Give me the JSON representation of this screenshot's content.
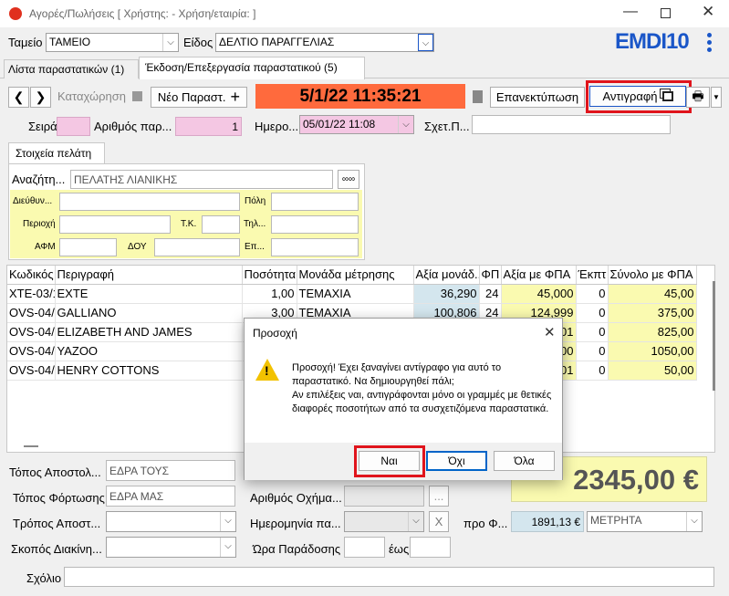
{
  "window": {
    "title": "Αγορές/Πωλήσεις  [ Χρήστης:             - Χρήση/εταιρία:             ]"
  },
  "header": {
    "cash_label": "Ταμείο",
    "cash_value": "ΤΑΜΕΙΟ",
    "type_label": "Είδος",
    "type_value": "ΔΕΛΤΙΟ ΠΑΡΑΓΓΕΛΙΑΣ",
    "logo": "EMDI10"
  },
  "tabs": [
    "Λίστα παραστατικών (1)",
    "Έκδοση/Επεξεργασία παραστατικού (5)"
  ],
  "toolbar": {
    "save_label": "Καταχώρηση",
    "new_label": "Νέο Παραστ.",
    "datetime": "5/1/22 11:35:21",
    "reprint_label": "Επανεκτύπωση",
    "copy_label": "Αντιγραφή"
  },
  "doc": {
    "series_label": "Σειρά",
    "number_label": "Αριθμός παρ...",
    "number_value": "1",
    "date_label": "Ημερο...",
    "date_value": "05/01/22 11:08",
    "related_label": "Σχετ.Π..."
  },
  "customer": {
    "section_label": "Στοιχεία πελάτη",
    "search_label": "Αναζήτη...",
    "search_value": "ΠΕΛΑΤΗΣ ΛΙΑΝΙΚΗΣ",
    "more_label": "∞∞",
    "address_label": "Διεύθυν...",
    "city_label": "Πόλη",
    "area_label": "Περιοχή",
    "zip_label": "Τ.Κ.",
    "phone_label": "Τηλ...",
    "vat_label": "ΑΦΜ",
    "tax_office_label": "ΔΟΥ",
    "job_label": "Επ..."
  },
  "grid": {
    "columns": [
      "Κωδικός",
      "Περιγραφή",
      "Ποσότητα",
      "Μονάδα μέτρησης",
      "Αξία μονάδ...",
      "ΦΠ",
      "Αξία με ΦΠΑ",
      "Έκπτ",
      "Σύνολο με ΦΠΑ"
    ],
    "rows": [
      [
        "XTE-03/1",
        "EXTE",
        "1,00",
        "ΤΕΜΑΧΙΑ",
        "36,290",
        "24",
        "45,000",
        "0",
        "45,00"
      ],
      [
        "OVS-04/",
        "GALLIANO",
        "3,00",
        "ΤΕΜΑΧΙΑ",
        "100,806",
        "24",
        "124,999",
        "0",
        "375,00"
      ],
      [
        "OVS-04/",
        "ELIZABETH AND JAMES",
        "",
        "",
        "",
        "",
        "01",
        "0",
        "825,00"
      ],
      [
        "OVS-04/",
        "YAZOO",
        "",
        "",
        "",
        "",
        "00",
        "0",
        "1050,00"
      ],
      [
        "OVS-04/",
        "HENRY COTTONS",
        "",
        "",
        "",
        "",
        "01",
        "0",
        "50,00"
      ]
    ]
  },
  "footer": {
    "ship_from_label": "Τόπος Αποστολ...",
    "ship_from_value": "ΕΔΡΑ ΤΟΥΣ",
    "load_place_label": "Τόπος Φόρτωσης",
    "load_place_value": "ΕΔΡΑ ΜΑΣ",
    "vehicle_label": "Αριθμός Οχήμα...",
    "ship_method_label": "Τρόπος Αποστ...",
    "date2_label": "Ημερομηνία πα...",
    "purpose_label": "Σκοπός Διακίνη...",
    "delivery_time_label": "Ώρα Παράδοσης",
    "until_label": "έως",
    "total": "2345,00 €",
    "pre_label": "προ Φ...",
    "pre_value": "1891,13 €",
    "payment_value": "ΜΕΤΡΗΤΑ",
    "comment_label": "Σχόλιο",
    "x_label": "X",
    "ellipsis_label": "..."
  },
  "dialog": {
    "title": "Προσοχή",
    "message1": "Προσοχή! Έχει ξαναγίνει αντίγραφο για αυτό το παραστατικό. Να δημιουργηθεί πάλι;",
    "message2": "Αν επιλέξεις ναι, αντιγράφονται μόνο οι γραμμές με θετικές διαφορές ποσοτήτων από τα συσχετιζόμενα παραστατικά.",
    "yes": "Ναι",
    "no": "Όχι",
    "all": "Όλα"
  },
  "colors": {
    "highlight": "#e0141c",
    "datetime_bg": "#ff6a3d",
    "pink": "#f4c7e3",
    "customer_bg": "#fafab0",
    "brand": "#1a56c8"
  }
}
